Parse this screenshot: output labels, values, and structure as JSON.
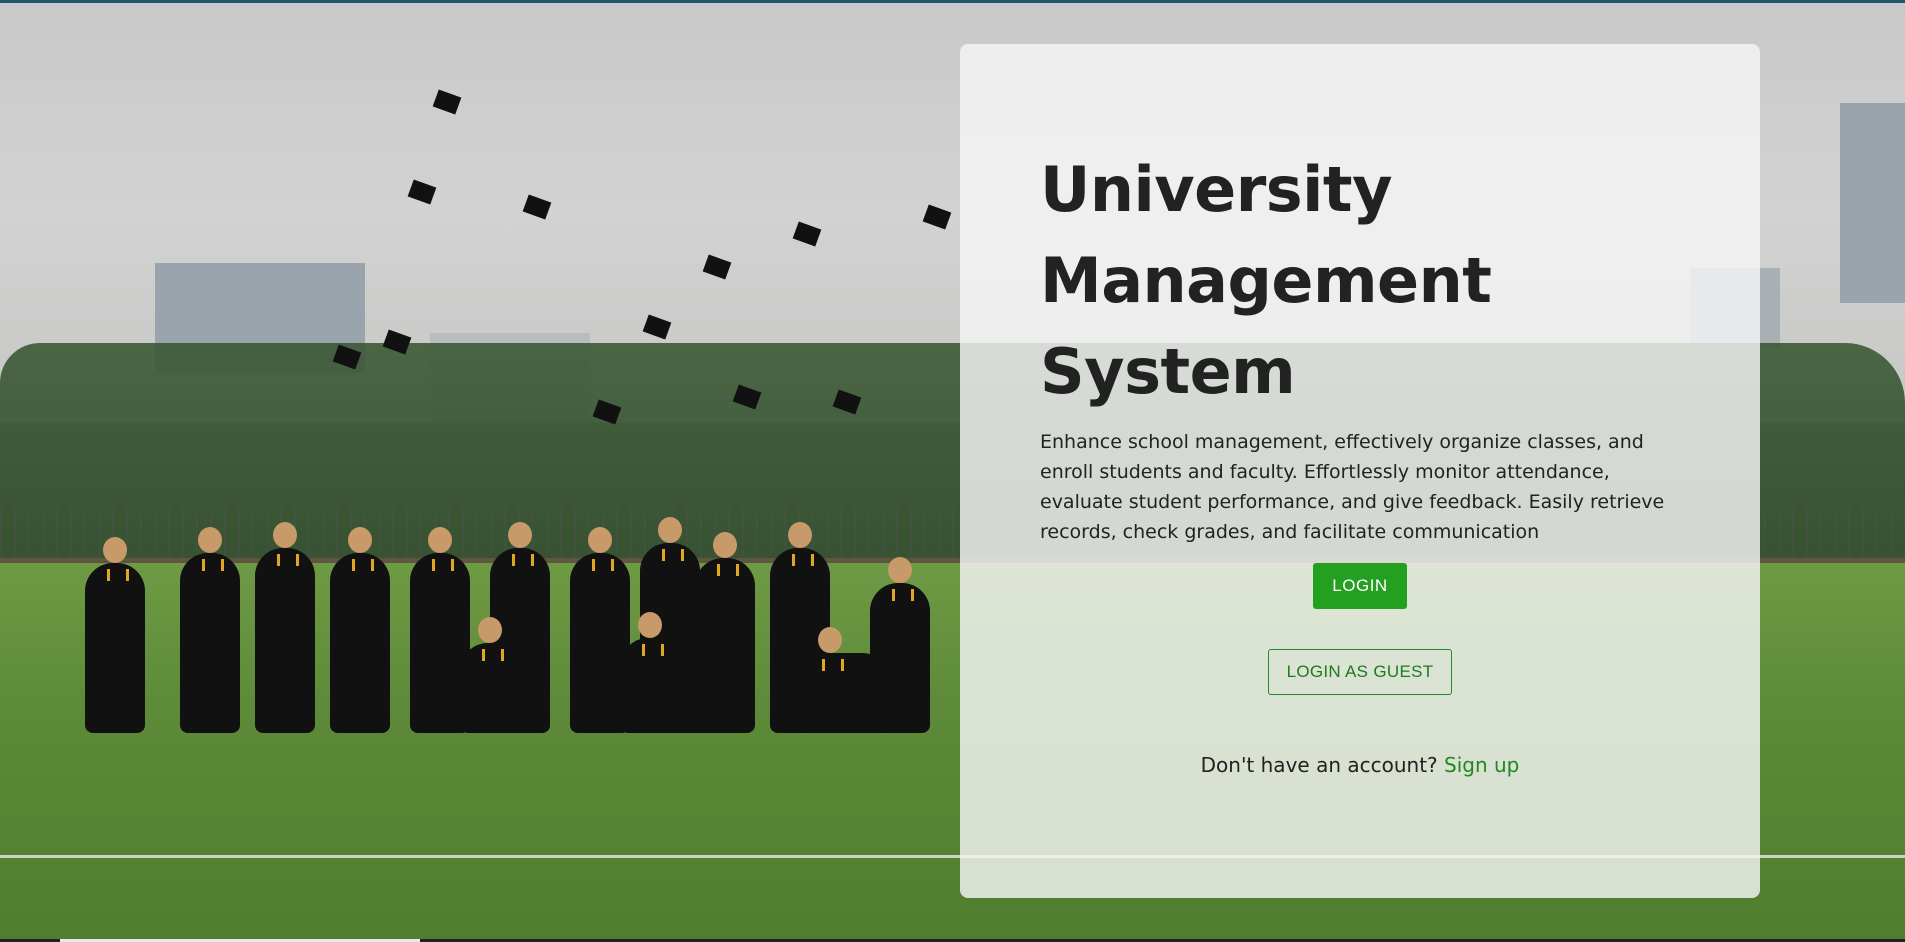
{
  "hero": {
    "title_lines": [
      "University",
      "Management",
      "System"
    ],
    "description": "Enhance school management, effectively organize classes, and enroll students and faculty. Effortlessly monitor attendance, evaluate student performance, and give feedback. Easily retrieve records, check grades, and facilitate communication"
  },
  "actions": {
    "login_label": "LOGIN",
    "guest_label": "LOGIN AS GUEST"
  },
  "signup": {
    "prompt": "Don't have an account?",
    "link_label": "Sign up"
  },
  "colors": {
    "primary": "#24a020",
    "link": "#1e8a1e",
    "card_bg": "rgba(245,245,245,0.82)"
  }
}
